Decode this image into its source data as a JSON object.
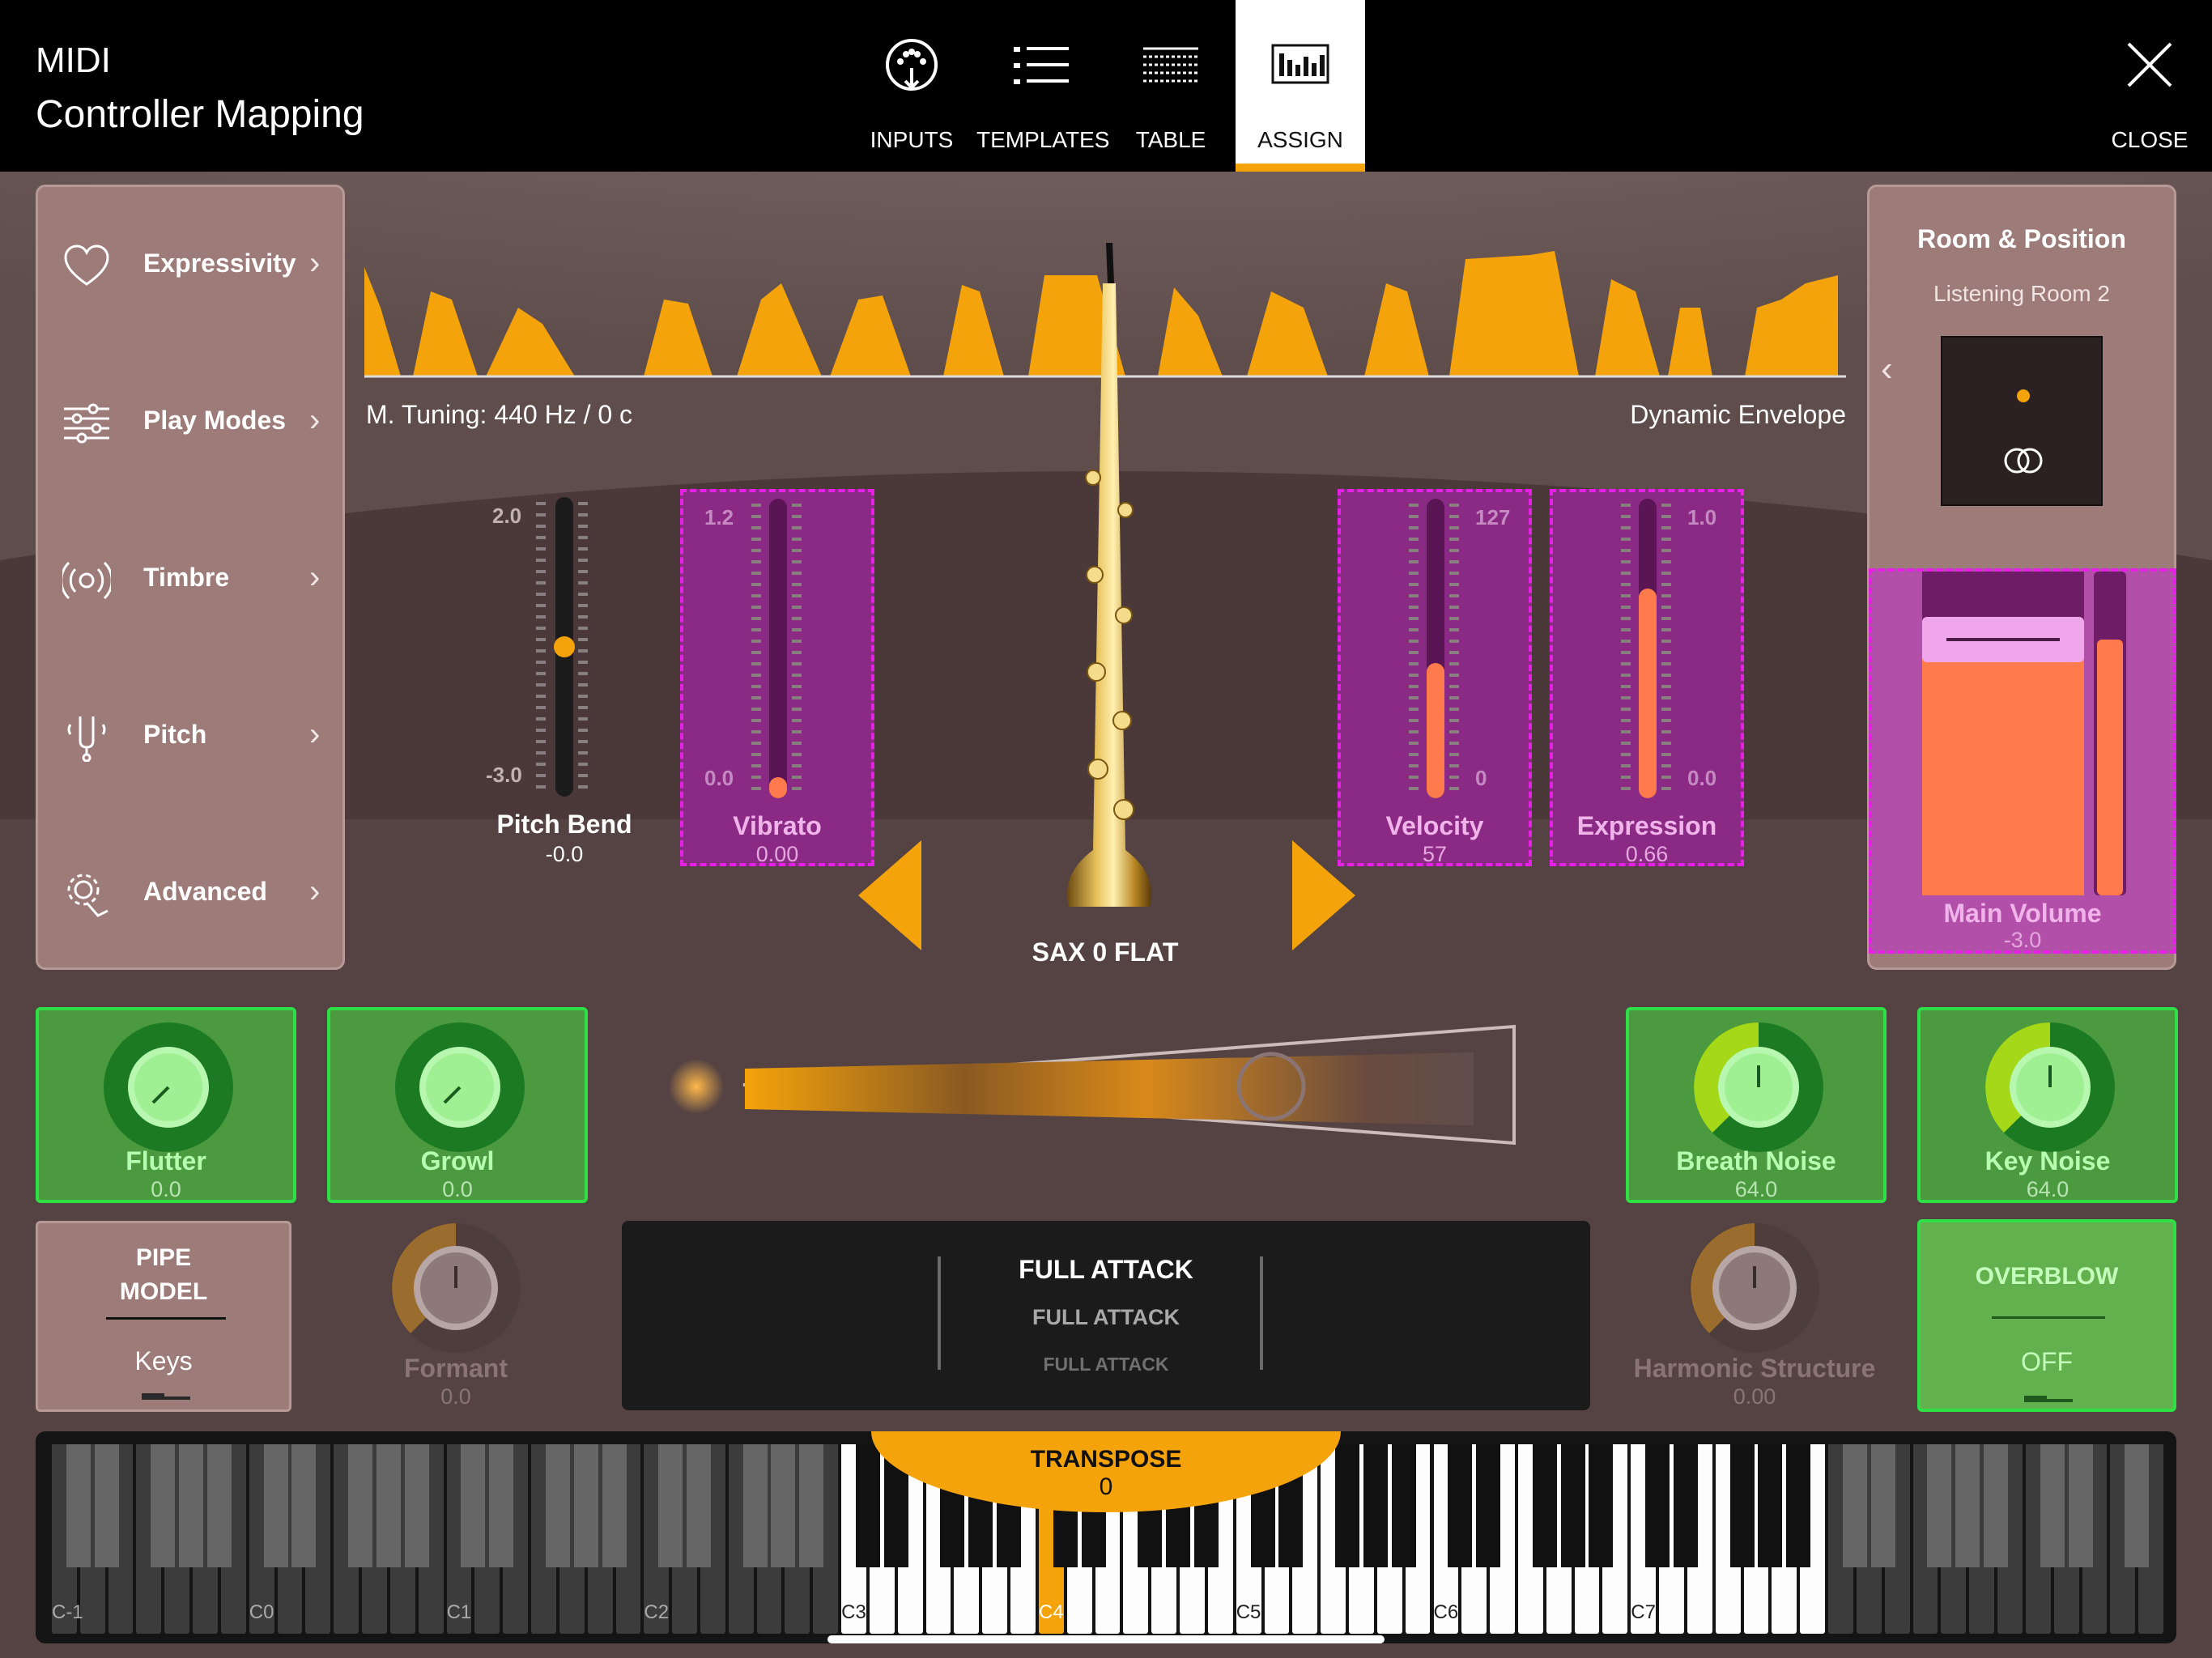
{
  "header": {
    "title_line1": "MIDI",
    "title_line2": "Controller Mapping",
    "tabs": [
      {
        "label": "INPUTS",
        "icon": "midi-port-icon"
      },
      {
        "label": "TEMPLATES",
        "icon": "list-icon"
      },
      {
        "label": "TABLE",
        "icon": "grid-table-icon"
      },
      {
        "label": "ASSIGN",
        "icon": "mixer-icon",
        "active": true
      }
    ],
    "close_label": "CLOSE"
  },
  "sidebar": {
    "items": [
      {
        "label": "Expressivity",
        "icon": "heart-icon"
      },
      {
        "label": "Play Modes",
        "icon": "sliders-icon"
      },
      {
        "label": "Timbre",
        "icon": "radio-waves-icon"
      },
      {
        "label": "Pitch",
        "icon": "tuning-fork-icon"
      },
      {
        "label": "Advanced",
        "icon": "gear-hand-icon"
      }
    ]
  },
  "envelope": {
    "tuning": "M. Tuning: 440 Hz / 0 c",
    "label": "Dynamic Envelope"
  },
  "sliders": {
    "pitch_bend": {
      "label": "Pitch Bend",
      "value": "-0.0",
      "max": "2.0",
      "min": "-3.0",
      "level": 0.5
    },
    "vibrato": {
      "label": "Vibrato",
      "value": "0.00",
      "max": "1.2",
      "min": "0.0",
      "level": 0.0
    },
    "velocity": {
      "label": "Velocity",
      "value": "57",
      "max": "127",
      "min": "0",
      "level": 0.45
    },
    "expression": {
      "label": "Expression",
      "value": "0.66",
      "max": "1.0",
      "min": "0.0",
      "level": 0.7
    }
  },
  "instrument": {
    "name": "SAX 0 FLAT"
  },
  "room": {
    "title": "Room & Position",
    "subtitle": "Listening Room 2",
    "main_volume_label": "Main Volume",
    "main_volume_value": "-3.0"
  },
  "knobs": {
    "flutter": {
      "label": "Flutter",
      "value": "0.0"
    },
    "growl": {
      "label": "Growl",
      "value": "0.0"
    },
    "breath_noise": {
      "label": "Breath Noise",
      "value": "64.0"
    },
    "key_noise": {
      "label": "Key Noise",
      "value": "64.0"
    },
    "formant": {
      "label": "Formant",
      "value": "0.0"
    },
    "harmonic_structure": {
      "label": "Harmonic Structure",
      "value": "0.00"
    }
  },
  "pipe_model": {
    "title_line1": "PIPE",
    "title_line2": "MODEL",
    "value": "Keys"
  },
  "attack_picker": {
    "selected": "FULL ATTACK",
    "option2": "FULL ATTACK",
    "option3": "FULL ATTACK"
  },
  "overblow": {
    "title": "OVERBLOW",
    "value": "OFF"
  },
  "keyboard": {
    "transpose_label": "TRANSPOSE",
    "transpose_value": "0",
    "octaves": [
      "C-1",
      "C0",
      "C1",
      "C2",
      "C3",
      "C4",
      "C5",
      "C6",
      "C7"
    ],
    "highlight_color": "#f5a30a"
  },
  "colors": {
    "accent": "#f5a30a",
    "assign_magenta": "#e620e6",
    "active_green": "#2ee046",
    "slider_fill": "#ff7a4d"
  }
}
